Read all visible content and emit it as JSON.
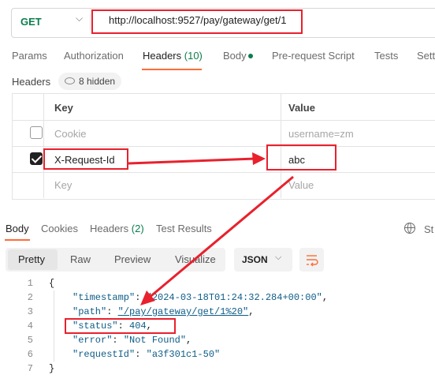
{
  "request": {
    "method": "GET",
    "url": "http://localhost:9527/pay/gateway/get/1"
  },
  "tabs": [
    {
      "label": "Params"
    },
    {
      "label": "Authorization"
    },
    {
      "label": "Headers",
      "count": "(10)"
    },
    {
      "label": "Body"
    },
    {
      "label": "Pre-request Script"
    },
    {
      "label": "Tests"
    },
    {
      "label": "Sett"
    }
  ],
  "headers_section": {
    "label": "Headers",
    "hidden_count": "8 hidden",
    "columns": {
      "key": "Key",
      "value": "Value"
    },
    "rows": [
      {
        "checked": false,
        "key": "Cookie",
        "value": "username=zm"
      },
      {
        "checked": true,
        "key": "X-Request-Id",
        "value": "abc"
      },
      {
        "checked": null,
        "key": "Key",
        "value": "Value"
      }
    ]
  },
  "response_tabs": [
    {
      "label": "Body"
    },
    {
      "label": "Cookies"
    },
    {
      "label": "Headers",
      "count": "(2)"
    },
    {
      "label": "Test Results"
    }
  ],
  "response_status_partial": "St",
  "view_modes": [
    "Pretty",
    "Raw",
    "Preview",
    "Visualize"
  ],
  "format": "JSON",
  "code": {
    "line_numbers": [
      "1",
      "2",
      "3",
      "4",
      "5",
      "6",
      "7"
    ],
    "open_brace": "{",
    "close_brace": "}",
    "timestamp_key": "\"timestamp\"",
    "timestamp_val": "\"2024-03-18T01:24:32.284+00:00\"",
    "path_key": "\"path\"",
    "path_val": "\"/pay/gateway/get/1%20\"",
    "status_key": "\"status\"",
    "status_val": "404",
    "error_key": "\"error\"",
    "error_val": "\"Not Found\"",
    "requestId_key": "\"requestId\"",
    "requestId_val": "\"a3f301c1-50\""
  },
  "colors": {
    "accent": "#ff6c37",
    "method_green": "#0c7d4e",
    "annotation_red": "#e8212d"
  }
}
